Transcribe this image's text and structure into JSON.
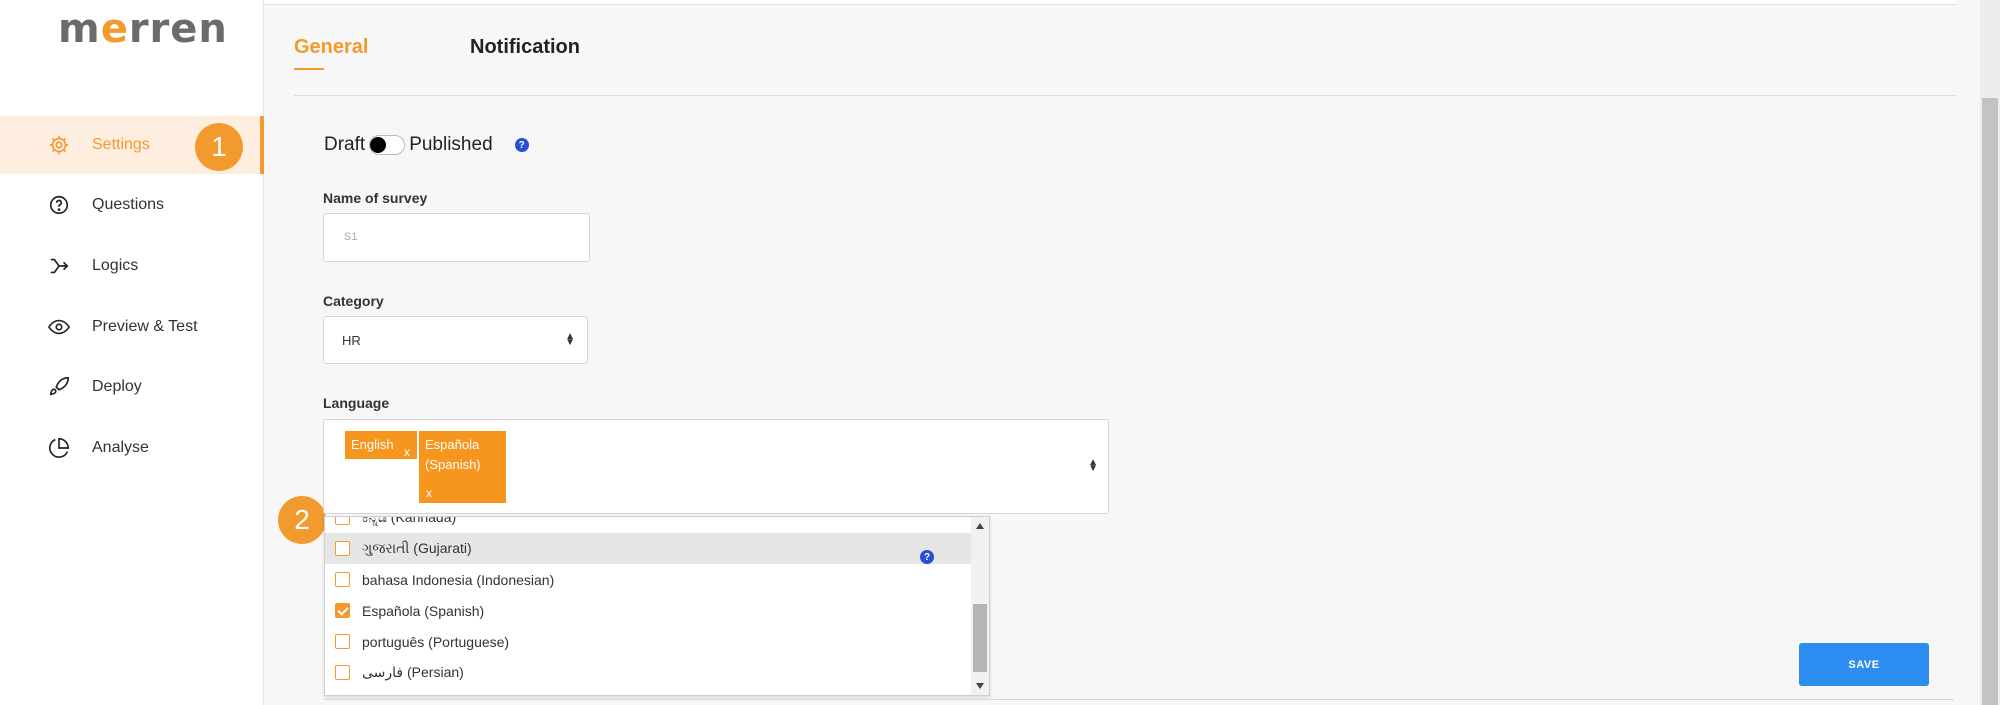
{
  "brand": {
    "logo_text_a": "m",
    "logo_text_b": "e",
    "logo_text_c": "rren",
    "accent_color": "#f39a2e"
  },
  "sidebar": {
    "items": [
      {
        "label": "Settings",
        "icon": "gear-icon",
        "active": true
      },
      {
        "label": "Questions",
        "icon": "question-circle-icon"
      },
      {
        "label": "Logics",
        "icon": "branch-icon"
      },
      {
        "label": "Preview & Test",
        "icon": "eye-icon"
      },
      {
        "label": "Deploy",
        "icon": "rocket-icon"
      },
      {
        "label": "Analyse",
        "icon": "pie-chart-icon"
      }
    ]
  },
  "badges": {
    "one": "1",
    "two": "2"
  },
  "tabs": {
    "general": "General",
    "notification": "Notification"
  },
  "status": {
    "draft": "Draft",
    "published": "Published",
    "help": "?"
  },
  "form": {
    "name_label": "Name of survey",
    "name_value": "S1",
    "category_label": "Category",
    "category_value": "HR",
    "language_label": "Language",
    "chips": [
      {
        "line1": "English",
        "remove": "x"
      },
      {
        "line1": "Española",
        "line2": "(Spanish)",
        "remove": "x"
      }
    ]
  },
  "dropdown": {
    "options": [
      {
        "label": "ಕನ್ನಡ (Kannada)",
        "checked": false
      },
      {
        "label": "ગુજરાતી (Gujarati)",
        "checked": false,
        "highlighted": true
      },
      {
        "label": "bahasa Indonesia (Indonesian)",
        "checked": false
      },
      {
        "label": "Española (Spanish)",
        "checked": true
      },
      {
        "label": "português (Portuguese)",
        "checked": false
      },
      {
        "label": "فارسی (Persian)",
        "checked": false
      }
    ]
  },
  "save_label": "SAVE"
}
